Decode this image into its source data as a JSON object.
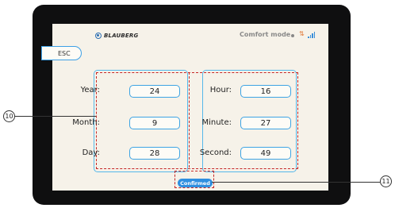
{
  "brand": {
    "name": "BLAUBERG",
    "icon": "blauberg-logo-icon"
  },
  "status": {
    "mode": "Comfort mode",
    "icons": [
      "dot-icon",
      "arrows-icon",
      "signal-icon"
    ],
    "signal_color": "#3a8fd9"
  },
  "esc": {
    "label": "ESC"
  },
  "date": [
    {
      "label": "Year:",
      "value": "24"
    },
    {
      "label": "Month:",
      "value": "9"
    },
    {
      "label": "Day:",
      "value": "28"
    }
  ],
  "time": [
    {
      "label": "Hour:",
      "value": "16"
    },
    {
      "label": "Minute:",
      "value": "27"
    },
    {
      "label": "Second:",
      "value": "49"
    }
  ],
  "confirm": {
    "label": "Confirmed"
  },
  "callouts": {
    "fields": "10",
    "button": "11"
  },
  "colors": {
    "accent": "#3ea4e4",
    "button": "#2f8fe0",
    "annotation": "#c62626",
    "bezel": "#0f0f10",
    "screen": "#f6f2e9"
  }
}
